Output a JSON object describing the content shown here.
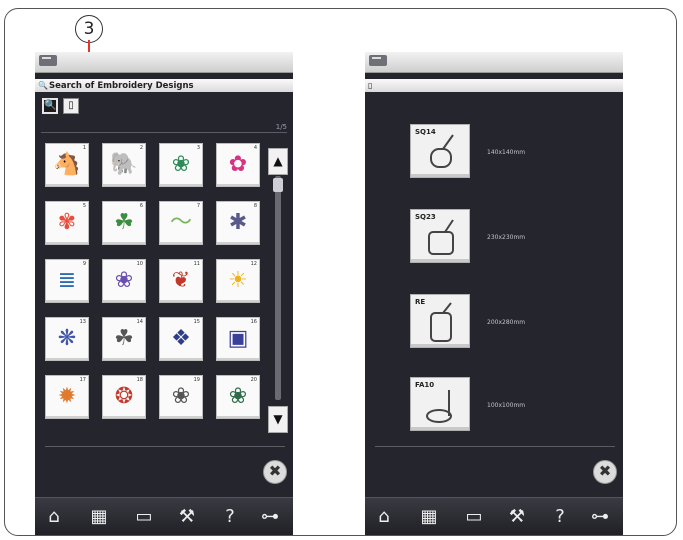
{
  "callout": {
    "label": "3"
  },
  "left_screen": {
    "title": "Search of Embroidery Designs",
    "page_indicator": "1/5",
    "tools": [
      {
        "icon": "magnifier-icon",
        "glyph": "🔍"
      },
      {
        "icon": "hoop-icon",
        "glyph": "▯"
      }
    ],
    "designs": [
      {
        "num": "1",
        "glyph": "🐴",
        "color": "#c0392b"
      },
      {
        "num": "2",
        "glyph": "🐘",
        "color": "#c0392b"
      },
      {
        "num": "3",
        "glyph": "❀",
        "color": "#2e8b57"
      },
      {
        "num": "4",
        "glyph": "✿",
        "color": "#d63384"
      },
      {
        "num": "5",
        "glyph": "✾",
        "color": "#e74c3c"
      },
      {
        "num": "6",
        "glyph": "☘",
        "color": "#3c8d40"
      },
      {
        "num": "7",
        "glyph": "〜",
        "color": "#7ab55c"
      },
      {
        "num": "8",
        "glyph": "✱",
        "color": "#5a5a8a"
      },
      {
        "num": "9",
        "glyph": "≣",
        "color": "#2f6db3"
      },
      {
        "num": "10",
        "glyph": "❀",
        "color": "#6a4fb0"
      },
      {
        "num": "11",
        "glyph": "❦",
        "color": "#c0392b"
      },
      {
        "num": "12",
        "glyph": "☀",
        "color": "#f0b21a"
      },
      {
        "num": "13",
        "glyph": "❋",
        "color": "#4054a8"
      },
      {
        "num": "14",
        "glyph": "☘",
        "color": "#555555"
      },
      {
        "num": "15",
        "glyph": "❖",
        "color": "#2f3d8a"
      },
      {
        "num": "16",
        "glyph": "▣",
        "color": "#3a3f9a"
      },
      {
        "num": "17",
        "glyph": "✹",
        "color": "#e07a2f"
      },
      {
        "num": "18",
        "glyph": "❂",
        "color": "#c0392b"
      },
      {
        "num": "19",
        "glyph": "❀",
        "color": "#555555"
      },
      {
        "num": "20",
        "glyph": "❀",
        "color": "#2f6b4a"
      }
    ],
    "scroll": {
      "up": "▲",
      "down": "▼"
    },
    "close": "✖"
  },
  "right_screen": {
    "title_icon": "▯",
    "hoops": [
      {
        "code": "SQ14",
        "size": "140x140mm"
      },
      {
        "code": "SQ23",
        "size": "230x230mm"
      },
      {
        "code": "RE",
        "size": "200x280mm"
      },
      {
        "code": "FA10",
        "size": "100x100mm"
      }
    ],
    "close": "✖"
  },
  "navbar": [
    {
      "name": "home-icon",
      "glyph": "⌂"
    },
    {
      "name": "embroidery-edit-icon",
      "glyph": "▦"
    },
    {
      "name": "file-open-icon",
      "glyph": "▭"
    },
    {
      "name": "settings-wrench-icon",
      "glyph": "⚒"
    },
    {
      "name": "help-icon",
      "glyph": "?"
    },
    {
      "name": "lock-key-icon",
      "glyph": "⊶"
    }
  ],
  "colors": {
    "screen_bg": "#25252e",
    "callout_line": "#e8342c"
  }
}
